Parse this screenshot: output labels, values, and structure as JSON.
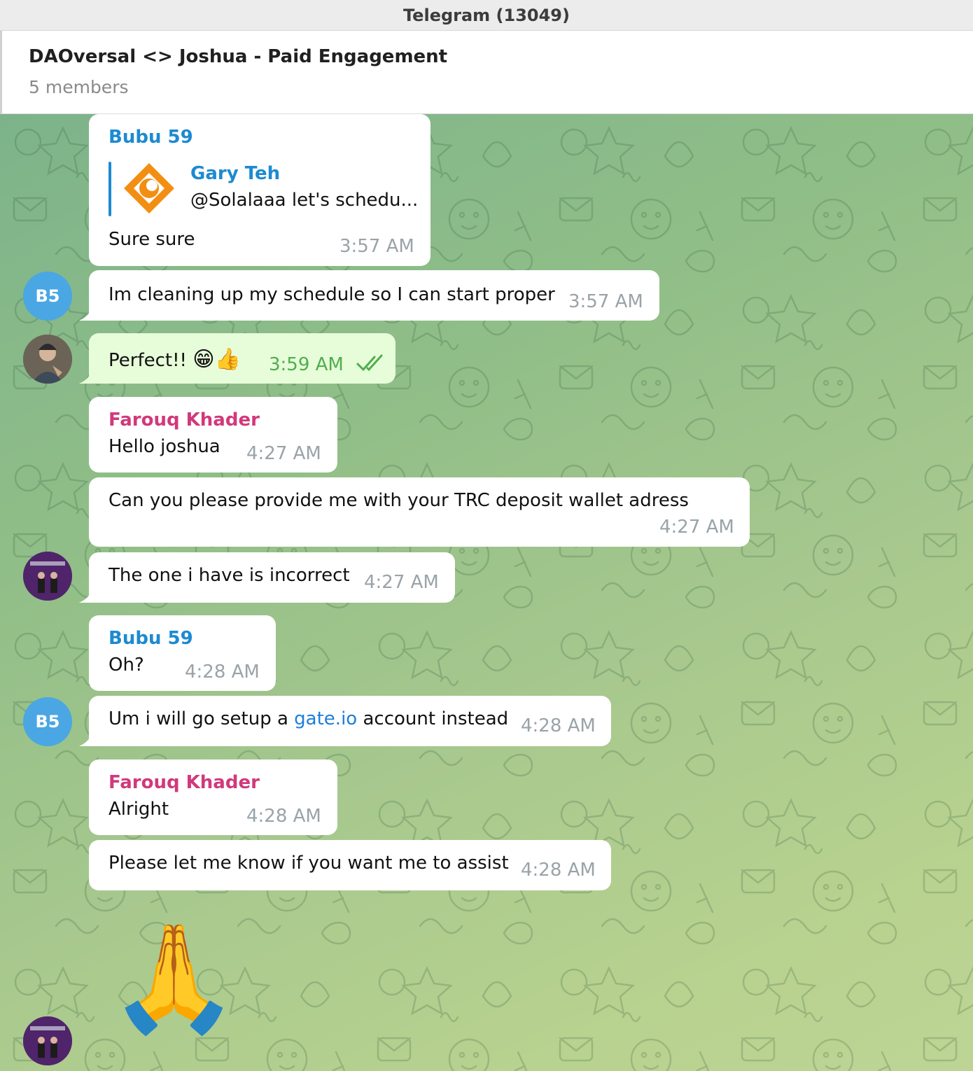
{
  "window": {
    "title": "Telegram (13049)"
  },
  "chat": {
    "title": "DAOversal <> Joshua - Paid Engagement",
    "subtitle": "5 members"
  },
  "avatars": {
    "b5_initials": "B5"
  },
  "messages": {
    "m1": {
      "sender": "Bubu 59",
      "reply_author": "Gary Teh",
      "reply_text": "@Solalaaa let's schedu...",
      "text": "Sure sure",
      "time": "3:57 AM"
    },
    "m2": {
      "text": "Im cleaning up my schedule so I can start proper",
      "time": "3:57 AM"
    },
    "m3": {
      "text": "Perfect!!",
      "emoji": "😁👍",
      "time": "3:59 AM"
    },
    "m4": {
      "sender": "Farouq Khader",
      "text": "Hello joshua",
      "time": "4:27 AM"
    },
    "m5": {
      "text": "Can you please provide me with your TRC deposit wallet adress",
      "time": "4:27 AM"
    },
    "m6": {
      "text": "The one i have is incorrect",
      "time": "4:27 AM"
    },
    "m7": {
      "sender": "Bubu 59",
      "text": "Oh?",
      "time": "4:28 AM"
    },
    "m8": {
      "text_before": "Um i will go setup a ",
      "link": "gate.io",
      "text_after": " account instead",
      "time": "4:28 AM"
    },
    "m9": {
      "sender": "Farouq Khader",
      "text": "Alright",
      "time": "4:28 AM"
    },
    "m10": {
      "text": "Please let me know if you want me to assist",
      "time": "4:28 AM"
    },
    "m11": {
      "emoji": "🙏"
    }
  },
  "colors": {
    "accent_blue": "#1d8ad1",
    "sender_pink": "#d1397b",
    "outgoing_bg": "#e7fcd9",
    "read_check": "#4fae4e"
  }
}
